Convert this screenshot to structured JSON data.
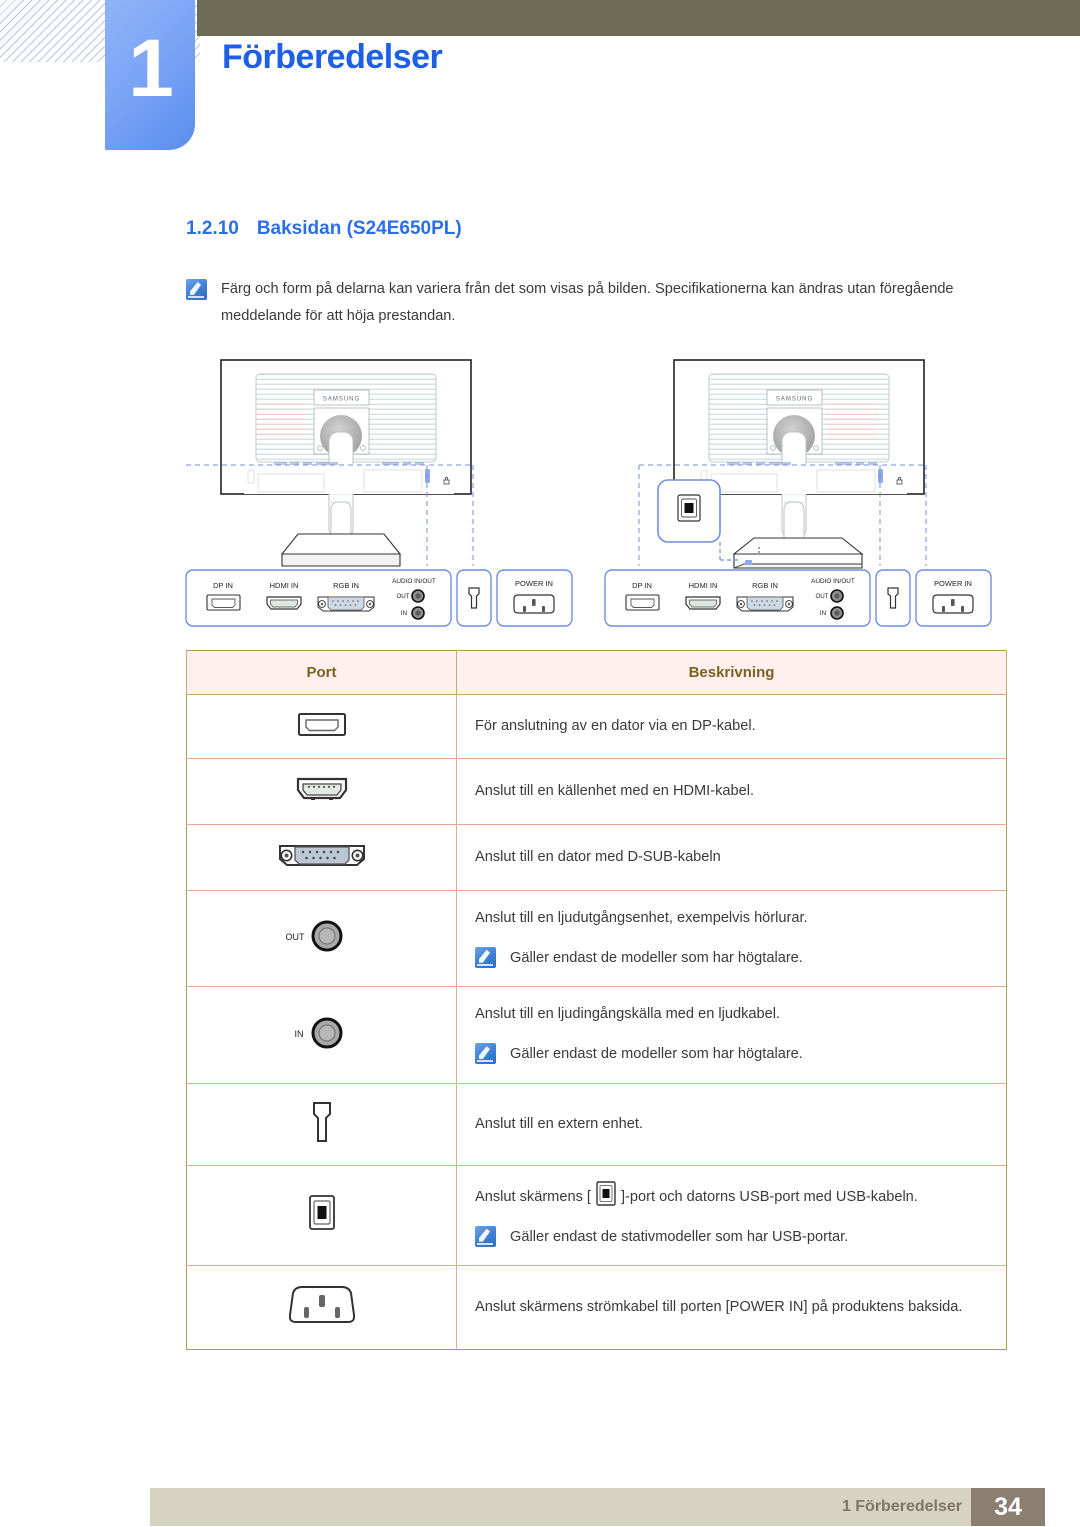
{
  "header": {
    "chapter_number": "1",
    "chapter_title": "Förberedelser"
  },
  "section": {
    "number": "1.2.10",
    "title": "Baksidan (S24E650PL)"
  },
  "note": {
    "icon": "note-pen-icon",
    "text": "Färg och form på delarna kan variera från det som visas på bilden. Specifikationerna kan ändras utan föregående meddelande för att höja prestandan."
  },
  "diagrams": {
    "left": {
      "brand_label": "SAMSUNG",
      "port_labels": [
        "DP IN",
        "HDMI IN",
        "RGB IN",
        "AUDIO IN/OUT",
        "OUT",
        "IN",
        "POWER IN"
      ]
    },
    "right": {
      "brand_label": "SAMSUNG",
      "port_labels": [
        "DP IN",
        "HDMI IN",
        "RGB IN",
        "AUDIO IN/OUT",
        "OUT",
        "IN",
        "POWER IN"
      ],
      "usb_callout": "usb-b-port-icon"
    }
  },
  "table": {
    "headers": {
      "port": "Port",
      "description": "Beskrivning"
    },
    "rows": [
      {
        "icon": "displayport-icon",
        "description": "För anslutning av en dator via en DP-kabel.",
        "subnote": null
      },
      {
        "icon": "hdmi-icon",
        "description": "Anslut till en källenhet med en HDMI-kabel.",
        "subnote": null
      },
      {
        "icon": "dsub-vga-icon",
        "description": "Anslut till en dator med D-SUB-kabeln",
        "subnote": null
      },
      {
        "icon": "audio-out-jack-icon",
        "icon_label": "OUT",
        "description": "Anslut till en ljudutgångsenhet, exempelvis hörlurar.",
        "subnote": "Gäller endast de modeller som har högtalare."
      },
      {
        "icon": "audio-in-jack-icon",
        "icon_label": "IN",
        "description": "Anslut till en ljudingångskälla med en ljudkabel.",
        "subnote": "Gäller endast de modeller som har högtalare."
      },
      {
        "icon": "external-device-port-icon",
        "description": "Anslut till en extern enhet.",
        "subnote": null
      },
      {
        "icon": "usb-b-upstream-icon",
        "description_before": "Anslut skärmens [",
        "description_after": "]-port och datorns USB-port med USB-kabeln.",
        "subnote": "Gäller endast de stativmodeller som har USB-portar."
      },
      {
        "icon": "power-in-socket-icon",
        "description": "Anslut skärmens strömkabel till porten [POWER IN] på produktens baksida.",
        "subnote": null
      }
    ]
  },
  "footer": {
    "label": "1 Förberedelser",
    "page_number": "34"
  },
  "colors": {
    "header_bar": "#6e6c56",
    "chapter_blue": "#5b8def",
    "title_blue": "#1e5fe8",
    "table_header_bg": "#fdf0ef",
    "table_header_text": "#7a6320",
    "footer_bar": "#d8d2c0",
    "footer_page_bg": "#8b7f72",
    "callout_blue": "#6f8fe0"
  }
}
